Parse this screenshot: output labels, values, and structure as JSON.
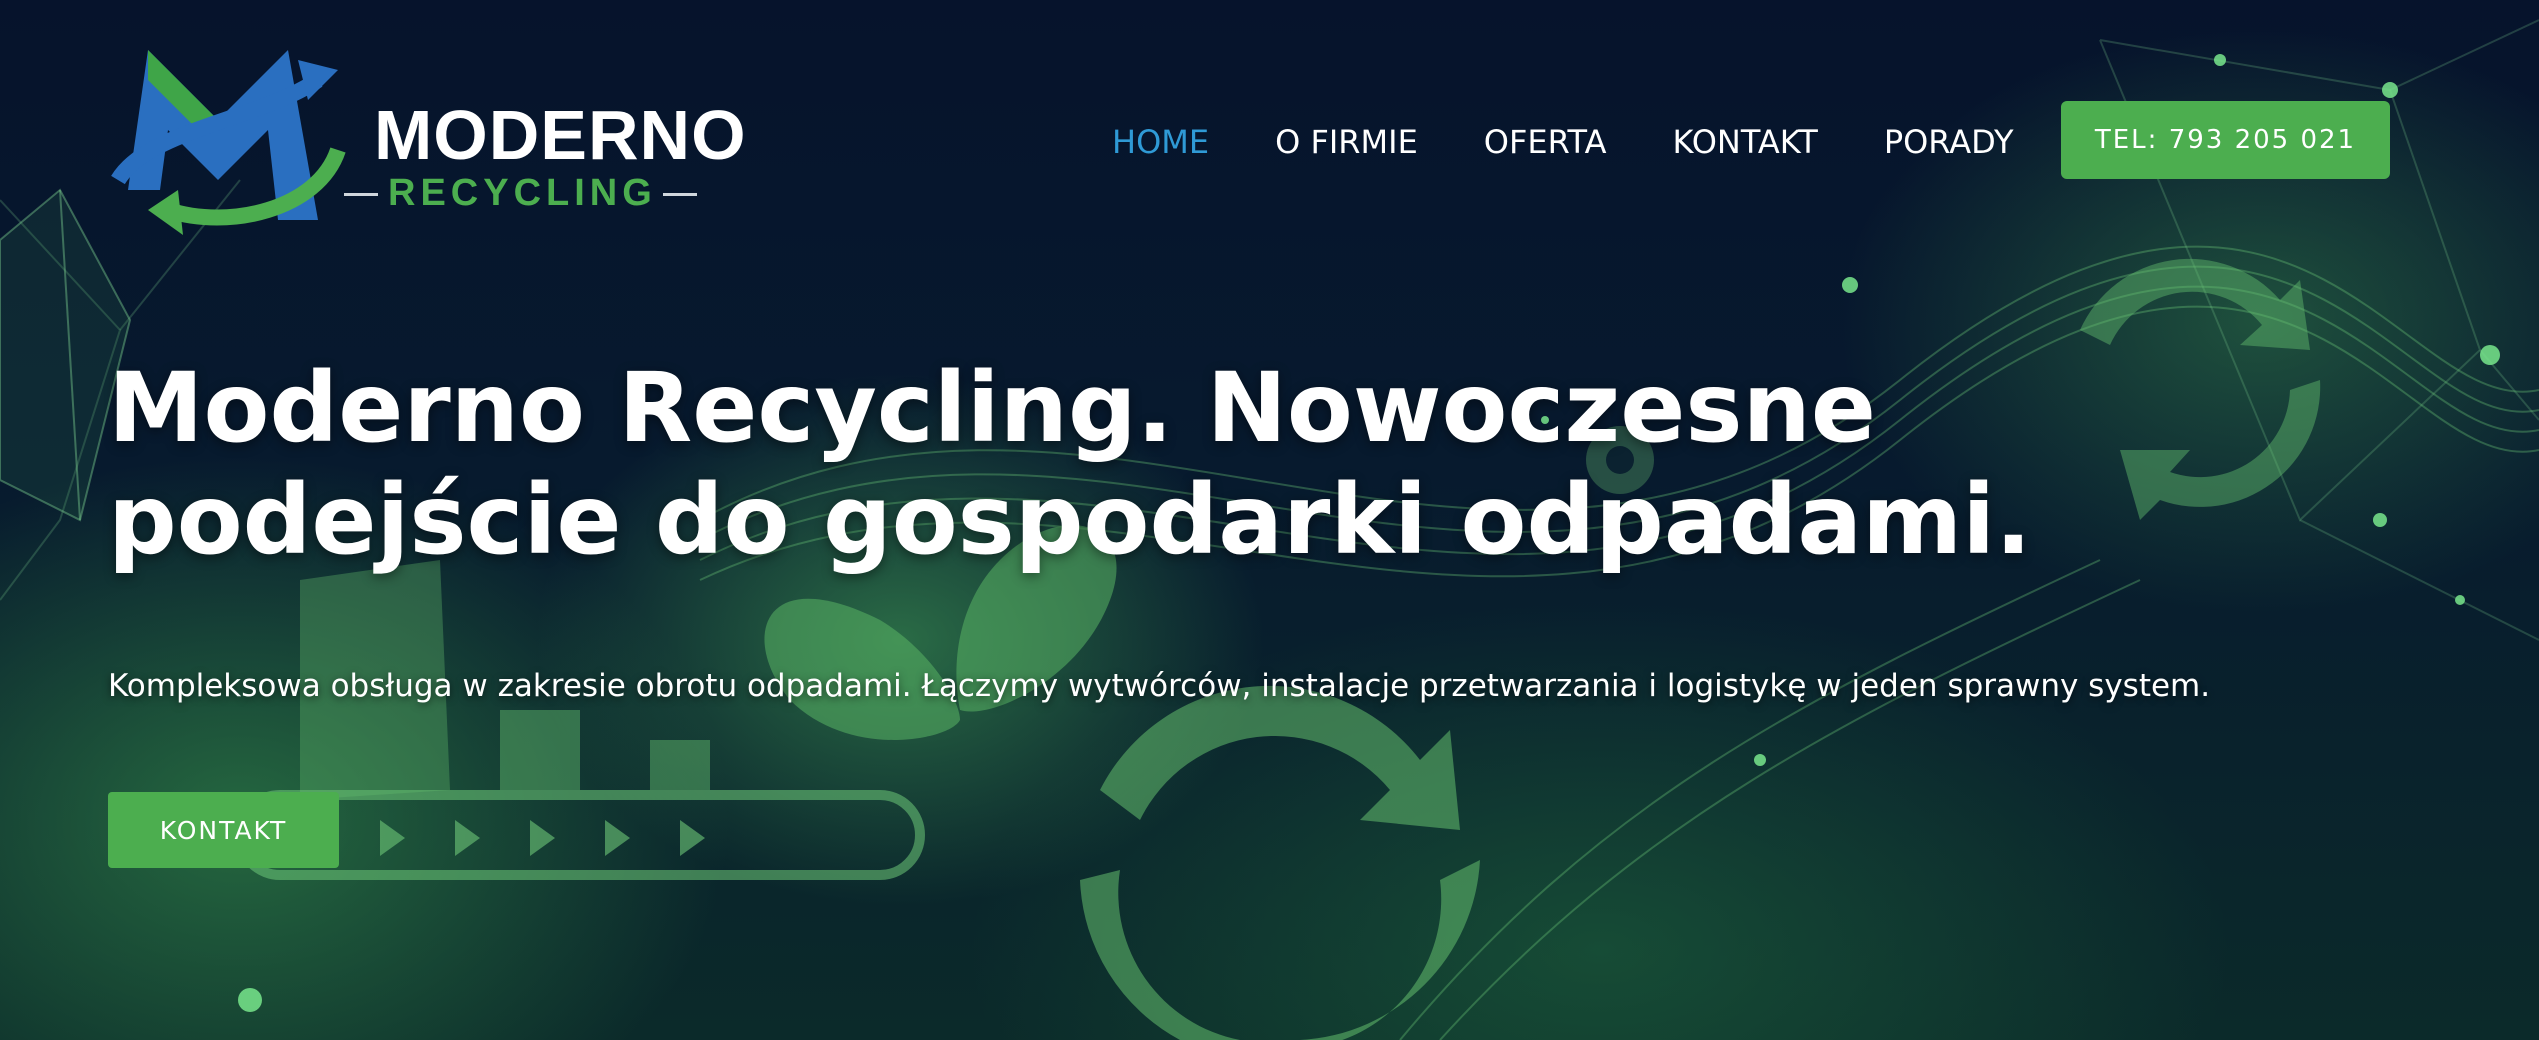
{
  "brand": {
    "name": "MODERNO",
    "tagline": "RECYCLING"
  },
  "nav": {
    "items": [
      {
        "label": "HOME",
        "active": true
      },
      {
        "label": "O FIRMIE",
        "active": false
      },
      {
        "label": "OFERTA",
        "active": false
      },
      {
        "label": "KONTAKT",
        "active": false
      },
      {
        "label": "PORADY",
        "active": false
      }
    ]
  },
  "header": {
    "phone_button": "TEL: 793 205 021"
  },
  "hero": {
    "title": "Moderno Recycling. Nowoczesne podejście do gospodarki odpadami.",
    "subtitle": "Kompleksowa obsługa w zakresie obrotu odpadami. Łączymy wytwórców, instalacje przetwarzania i logistykę w jeden sprawny system.",
    "cta_label": "KONTAKT"
  },
  "colors": {
    "accent_green": "#4cae4f",
    "nav_active": "#2f9ad6",
    "background": "#041028",
    "logo_blue": "#2a6fc0"
  },
  "icons": [
    "recycle-logo-icon",
    "recycle-arrows-icon",
    "leaf-icon",
    "gear-icon",
    "conveyor-icon"
  ]
}
